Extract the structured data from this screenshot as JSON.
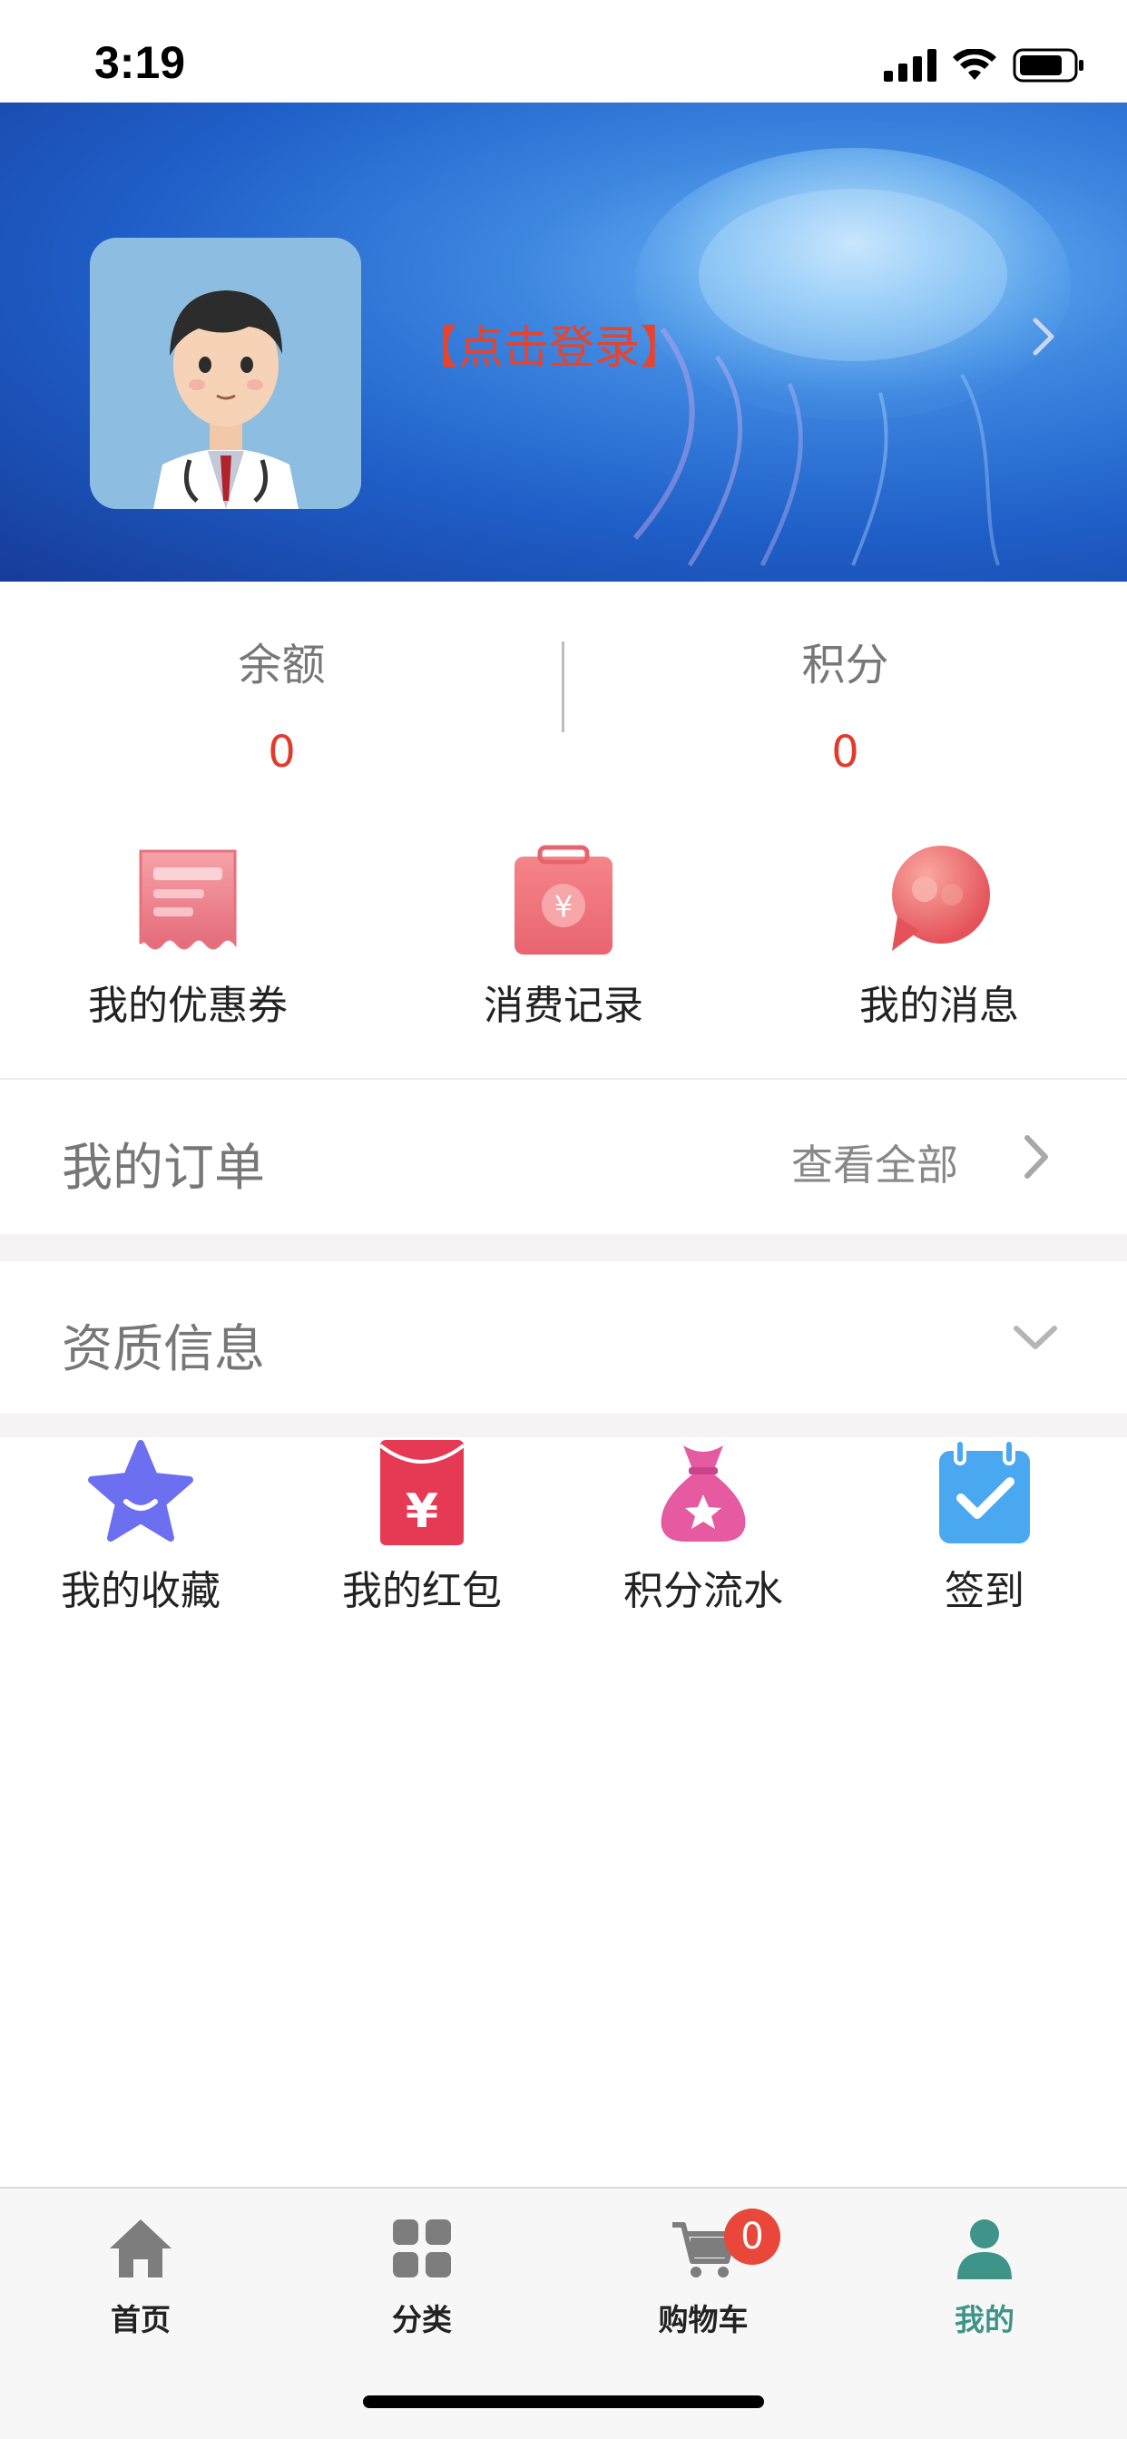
{
  "status_bar": {
    "time": "3:19"
  },
  "header": {
    "login_text": "【点击登录】"
  },
  "stats": {
    "balance_label": "余额",
    "balance_value": "0",
    "points_label": "积分",
    "points_value": "0"
  },
  "quick_links": [
    {
      "label": "我的优惠券",
      "icon": "coupon-icon"
    },
    {
      "label": "消费记录",
      "icon": "receipt-bag-icon"
    },
    {
      "label": "我的消息",
      "icon": "message-bubble-icon"
    }
  ],
  "orders": {
    "title": "我的订单",
    "view_all": "查看全部"
  },
  "qualification": {
    "title": "资质信息"
  },
  "tools": [
    {
      "label": "我的收藏",
      "icon": "star-icon",
      "color": "#6b6ff0"
    },
    {
      "label": "我的红包",
      "icon": "red-envelope-icon",
      "color": "#e63a54"
    },
    {
      "label": "积分流水",
      "icon": "money-bag-icon",
      "color": "#e55aa0"
    },
    {
      "label": "签到",
      "icon": "calendar-check-icon",
      "color": "#4aa8f0"
    }
  ],
  "tabbar": {
    "items": [
      {
        "label": "首页",
        "icon": "home-icon"
      },
      {
        "label": "分类",
        "icon": "category-grid-icon"
      },
      {
        "label": "购物车",
        "icon": "cart-icon"
      },
      {
        "label": "我的",
        "icon": "user-icon"
      }
    ],
    "cart_badge": "0",
    "active": "我的",
    "active_color": "#3e9489"
  },
  "colors": {
    "accent_red": "#e23b2c",
    "login_red": "#e8432b"
  }
}
